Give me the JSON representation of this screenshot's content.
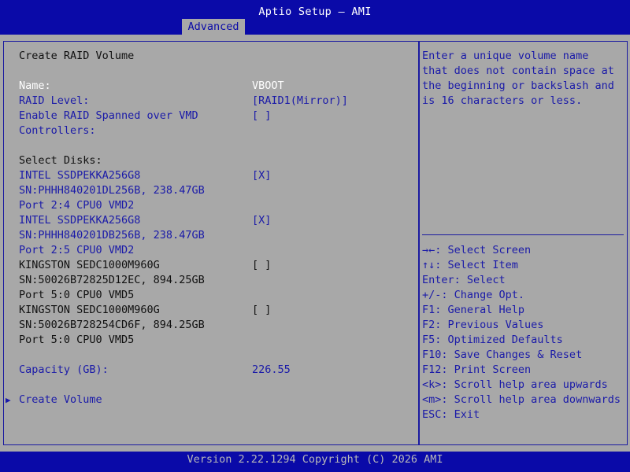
{
  "header": {
    "title": "Aptio Setup – AMI",
    "tab": "Advanced"
  },
  "page": {
    "heading": "Create RAID Volume",
    "fields": {
      "name_label": "Name:",
      "name_value": "VBOOT",
      "raid_level_label": "RAID Level:",
      "raid_level_value": "[RAID1(Mirror)]",
      "spanned_label_1": "Enable RAID Spanned over VMD",
      "spanned_label_2": "Controllers:",
      "spanned_value": "[ ]"
    },
    "select_disks_label": "Select Disks:",
    "disks": [
      {
        "model": "INTEL SSDPEKKA256G8",
        "serial": "SN:PHHH840201DL256B, 238.47GB",
        "port": "Port 2:4 CPU0 VMD2",
        "checked": "[X]"
      },
      {
        "model": "INTEL SSDPEKKA256G8",
        "serial": "SN:PHHH840201DB256B, 238.47GB",
        "port": "Port 2:5 CPU0 VMD2",
        "checked": "[X]"
      },
      {
        "model": "KINGSTON SEDC1000M960G",
        "serial": "SN:50026B72825D12EC, 894.25GB",
        "port": "Port 5:0 CPU0 VMD5",
        "checked": "[ ]"
      },
      {
        "model": "KINGSTON SEDC1000M960G",
        "serial": "SN:50026B728254CD6F, 894.25GB",
        "port": "Port 5:0 CPU0 VMD5",
        "checked": "[ ]"
      }
    ],
    "capacity_label": "Capacity (GB):",
    "capacity_value": "226.55",
    "create_volume": "Create Volume",
    "arrow_glyph": "▶"
  },
  "help": {
    "text": [
      "Enter a unique volume name",
      "that does not contain space at",
      "the beginning or backslash and",
      "is 16 characters or less."
    ],
    "keys": [
      "→←: Select Screen",
      "↑↓: Select Item",
      "Enter: Select",
      "+/-: Change Opt.",
      "F1: General Help",
      "F2: Previous Values",
      "F5: Optimized Defaults",
      "F10: Save Changes & Reset",
      "F12: Print Screen",
      "<k>: Scroll help area upwards",
      "<m>: Scroll help area downwards",
      "ESC: Exit"
    ]
  },
  "footer": {
    "version": "Version 2.22.1294 Copyright (C) 2026 AMI"
  },
  "colors": {
    "bar": "#0a0aa8",
    "panel": "#a8a8a8",
    "link": "#1a1aa8",
    "text": "#101010"
  }
}
